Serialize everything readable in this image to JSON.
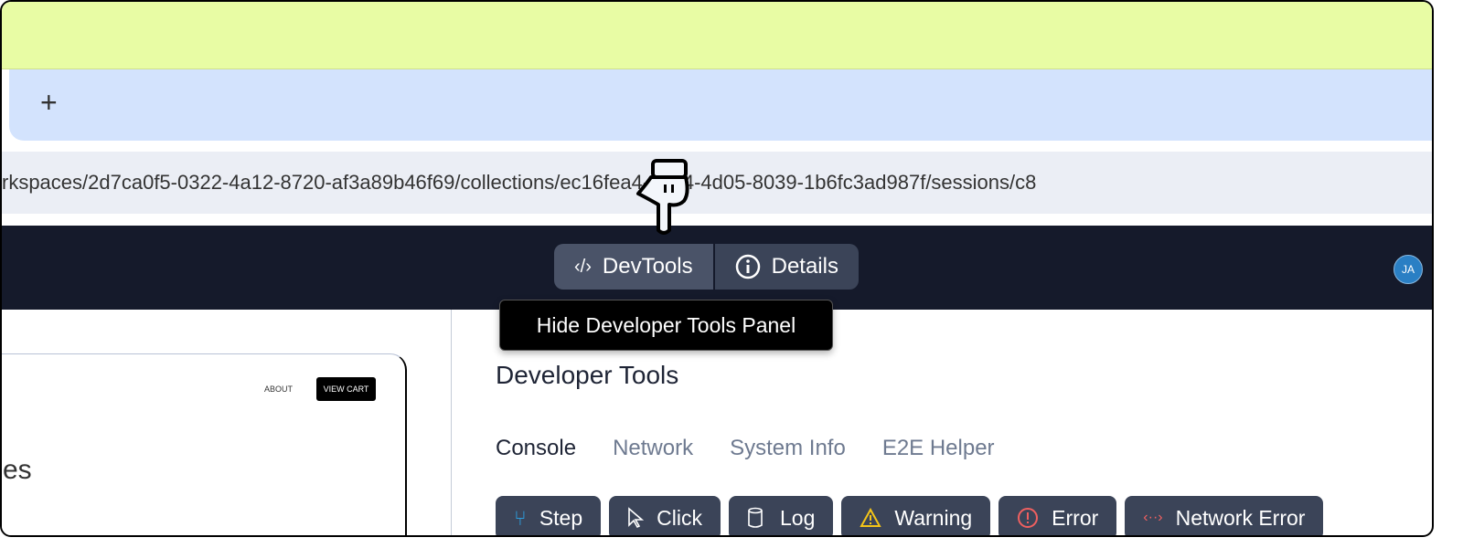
{
  "browser": {
    "new_tab_label": "+",
    "url": "rkspaces/2d7ca0f5-0322-4a12-8720-af3a89b46f69/collections/ec16fea4-3e04-4d05-8039-1b6fc3ad987f/sessions/c8"
  },
  "nav": {
    "devtools_label": "DevTools",
    "details_label": "Details",
    "avatar_initials": "JA",
    "tooltip": "Hide Developer Tools Panel"
  },
  "preview": {
    "about": "ABOUT",
    "view_cart": "VIEW CART",
    "heading_fragment": "es"
  },
  "devtools": {
    "title": "Developer Tools",
    "tabs": [
      {
        "label": "Console",
        "active": true
      },
      {
        "label": "Network"
      },
      {
        "label": "System Info"
      },
      {
        "label": "E2E Helper"
      }
    ],
    "filters": [
      {
        "label": "Step",
        "icon": "step-icon",
        "color": "#2d9cdb"
      },
      {
        "label": "Click",
        "icon": "pointer-icon",
        "color": "#ffffff"
      },
      {
        "label": "Log",
        "icon": "log-icon",
        "color": "#ffffff"
      },
      {
        "label": "Warning",
        "icon": "warning-icon",
        "color": "#f5c518"
      },
      {
        "label": "Error",
        "icon": "error-icon",
        "color": "#f06060"
      },
      {
        "label": "Network Error",
        "icon": "network-error-icon",
        "color": "#f06060"
      }
    ]
  },
  "colors": {
    "nav_bg": "#151a2b",
    "button_bg": "#3b4458",
    "tab_strip": "#d3e3fd",
    "top_band": "#e8fca4"
  }
}
